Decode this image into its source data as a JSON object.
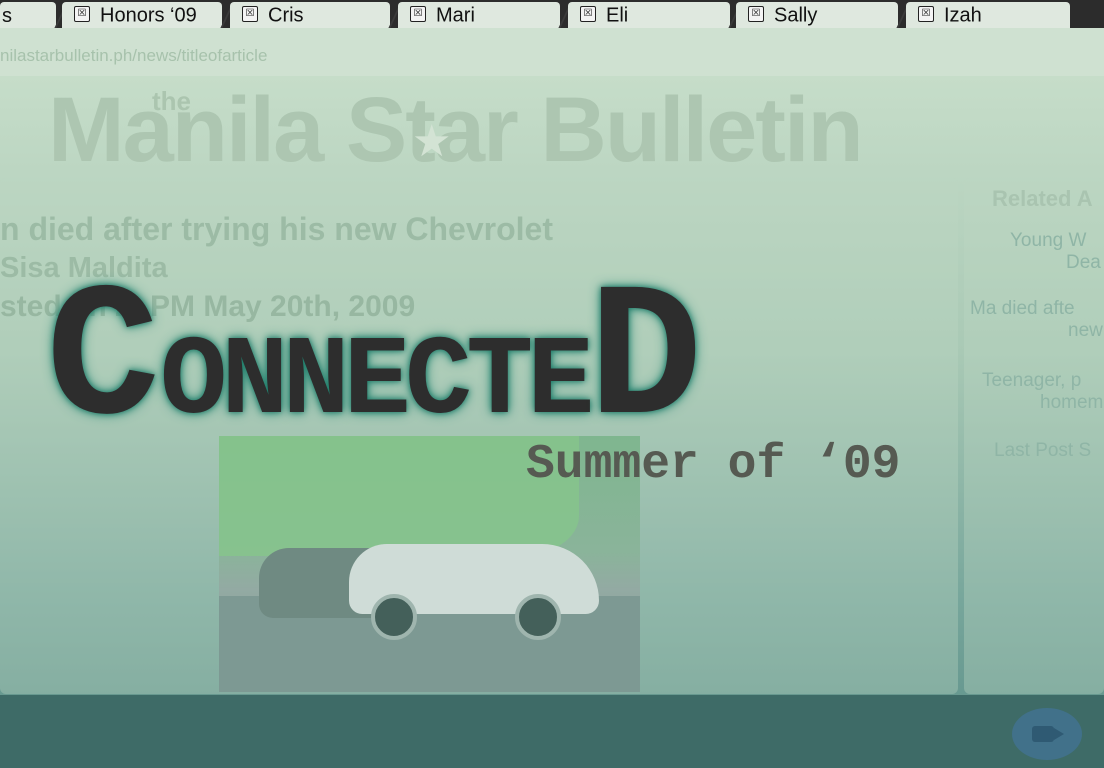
{
  "browser": {
    "tabs": [
      {
        "label": "s"
      },
      {
        "label": "Honors ‘09"
      },
      {
        "label": "Cris"
      },
      {
        "label": "Mari"
      },
      {
        "label": "Eli"
      },
      {
        "label": "Sally"
      },
      {
        "label": "Izah"
      }
    ],
    "tab_icon": "☒",
    "url": "nilastarbulletin.ph/news/titleofarticle"
  },
  "site": {
    "the": "the",
    "masthead": "Manila Star Bulletin",
    "star": "★"
  },
  "article": {
    "headline": "n died after trying his new Chevrolet",
    "author": "Sisa Maldita",
    "posted": "sted on 2:    PM May 20th, 2009"
  },
  "related": {
    "title": "Related A",
    "items": [
      {
        "line1": "Young W",
        "line2": "Dea"
      },
      {
        "line1": "Ma died afte",
        "line2": "new"
      },
      {
        "line1": "Teenager, p",
        "line2": "homem"
      },
      {
        "line1": "Last Post S",
        "line2": ""
      }
    ]
  },
  "overlay": {
    "title_first": "C",
    "title_middle": "ONNECTE",
    "title_last": "D",
    "subtitle": "Summer of ‘09"
  },
  "colors": {
    "accent_glow": "#1f7a68",
    "page_top": "#c6ddc9",
    "page_bottom": "#5c8f88",
    "bottom_bar": "#3e6b67"
  },
  "icons": {
    "tab_favicon": "favicon-icon",
    "chat": "video-chat-icon"
  }
}
